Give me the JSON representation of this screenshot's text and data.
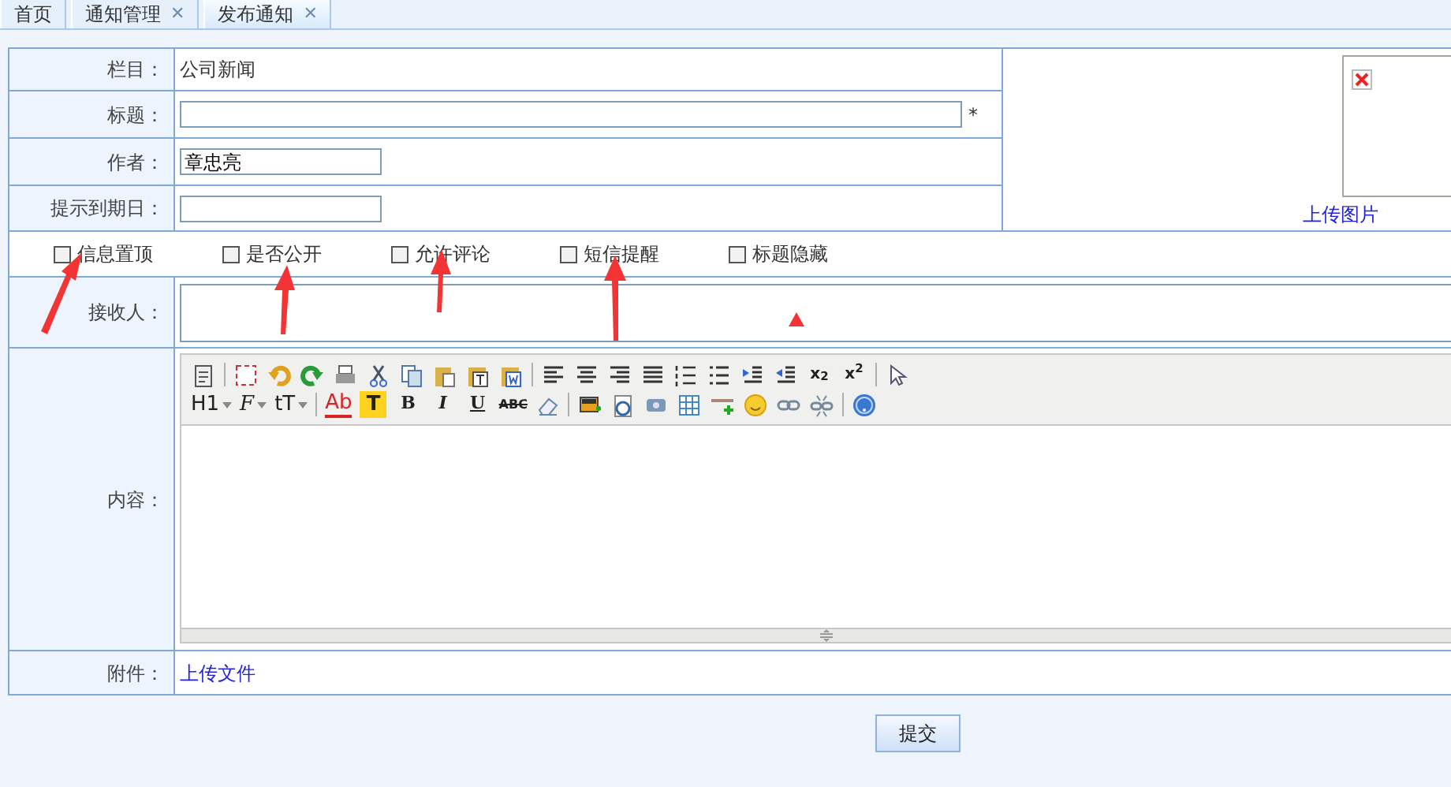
{
  "tabs": [
    {
      "label": "首页",
      "selected": false
    },
    {
      "label": "通知管理",
      "selected": false,
      "close": "✕"
    },
    {
      "label": "发布通知",
      "selected": true,
      "close": "✕"
    }
  ],
  "form": {
    "fields": [
      {
        "kind": "text",
        "label": "栏目：",
        "value": "公司新闻"
      },
      {
        "kind": "long-input",
        "label": "标题：",
        "required_mark": "*"
      },
      {
        "kind": "short-input",
        "label": "作者：",
        "value": "章忠亮"
      },
      {
        "kind": "short-input",
        "label": "提示到期日："
      }
    ],
    "image_upload": {
      "link": "上传图片"
    },
    "options": [
      {
        "label": "信息置顶",
        "checked": false
      },
      {
        "label": "是否公开",
        "checked": false
      },
      {
        "label": "允许评论",
        "checked": false
      },
      {
        "label": "短信提醒",
        "checked": false
      },
      {
        "label": "标题隐藏",
        "checked": false
      }
    ],
    "recipients": {
      "label": "接收人："
    },
    "content": {
      "label": "内容：",
      "toolbar_rows": [
        [
          {
            "kind": "source"
          },
          {
            "kind": "separator"
          },
          {
            "kind": "preview"
          },
          {
            "kind": "undo"
          },
          {
            "kind": "redo"
          },
          {
            "kind": "print"
          },
          {
            "kind": "cut"
          },
          {
            "kind": "copy"
          },
          {
            "kind": "paste"
          },
          {
            "kind": "paste-text"
          },
          {
            "kind": "paste-word"
          },
          {
            "kind": "separator"
          },
          {
            "kind": "align-left"
          },
          {
            "kind": "align-center"
          },
          {
            "kind": "align-right"
          },
          {
            "kind": "justify"
          },
          {
            "kind": "ordered-list"
          },
          {
            "kind": "bullet-list"
          },
          {
            "kind": "indent"
          },
          {
            "kind": "outdent"
          },
          {
            "kind": "script",
            "label": "x$_{2}$"
          },
          {
            "kind": "script",
            "label": "x$^{2}$"
          },
          {
            "kind": "separator"
          },
          {
            "kind": "cursor"
          }
        ],
        [
          {
            "kind": "dropdown",
            "label": "H1"
          },
          {
            "kind": "dropdown-italic",
            "label": "F"
          },
          {
            "kind": "dropdown",
            "label": "tT"
          },
          {
            "kind": "separator"
          },
          {
            "kind": "forecolor",
            "label": "Ab"
          },
          {
            "kind": "highlight",
            "label": "T"
          },
          {
            "kind": "bold",
            "label": "B"
          },
          {
            "kind": "italic",
            "label": "I"
          },
          {
            "kind": "underline",
            "label": "U"
          },
          {
            "kind": "strike",
            "label": "ABC"
          },
          {
            "kind": "eraser"
          },
          {
            "kind": "separator"
          },
          {
            "kind": "image"
          },
          {
            "kind": "flash"
          },
          {
            "kind": "media"
          },
          {
            "kind": "table"
          },
          {
            "kind": "rule"
          },
          {
            "kind": "smiley"
          },
          {
            "kind": "link"
          },
          {
            "kind": "unlink"
          },
          {
            "kind": "separator"
          },
          {
            "kind": "help"
          }
        ]
      ]
    },
    "attachment": {
      "label": "附件：",
      "link": "上传文件"
    }
  },
  "submit": "提交"
}
